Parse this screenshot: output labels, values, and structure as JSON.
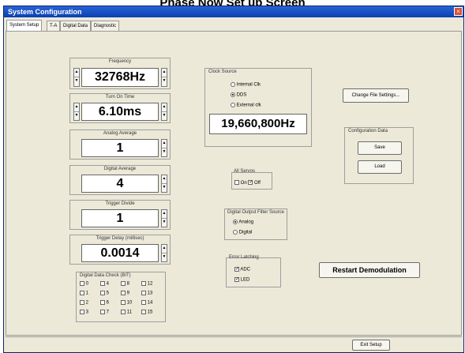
{
  "page_heading": "Phase Now Set up Screen",
  "window": {
    "title": "System Configuration",
    "close_glyph": "×"
  },
  "tabs": [
    "System Setup",
    "T-A",
    "Digital Data",
    "Diagnostic"
  ],
  "frequency": {
    "label": "Frequency",
    "value": "32768Hz"
  },
  "turn_on_time": {
    "label": "Turn On Time",
    "value": "6.10ms"
  },
  "analog_average": {
    "label": "Analog Average",
    "value": "1"
  },
  "digital_average": {
    "label": "Digital Average",
    "value": "4"
  },
  "trigger_divide": {
    "label": "Trigger Divide",
    "value": "1"
  },
  "trigger_delay": {
    "label": "Trigger Delay (millisec)",
    "value": "0.0014"
  },
  "clock_source": {
    "label": "Clock Source",
    "options": [
      "Internal Clk",
      "DDS",
      "External clk"
    ],
    "selected": "DDS",
    "value": "19,660,800Hz"
  },
  "all_servos": {
    "label": "All Servos",
    "on_label": "On",
    "off_label": "Off",
    "on_checked": false,
    "off_checked": true
  },
  "filter_source": {
    "label": "Digital Output Filter Source",
    "options": [
      "Analog",
      "Digital"
    ],
    "selected": "Analog"
  },
  "error_latching": {
    "label": "Error Latching",
    "adc_label": "ADC",
    "led_label": "LED",
    "adc_checked": true,
    "led_checked": true
  },
  "digital_check": {
    "label": "Digital Data Check (BIT)",
    "bits": [
      "0",
      "4",
      "8",
      "12",
      "1",
      "5",
      "9",
      "13",
      "2",
      "6",
      "10",
      "14",
      "3",
      "7",
      "11",
      "15"
    ]
  },
  "buttons": {
    "change_file": "Change File Settings...",
    "save": "Save",
    "load": "Load",
    "restart": "Restart Demodulation",
    "exit": "Exit Setup"
  },
  "config_data_label": "Configuration Data",
  "spin_up": "▲",
  "spin_down": "▼",
  "check_mark": "✓"
}
